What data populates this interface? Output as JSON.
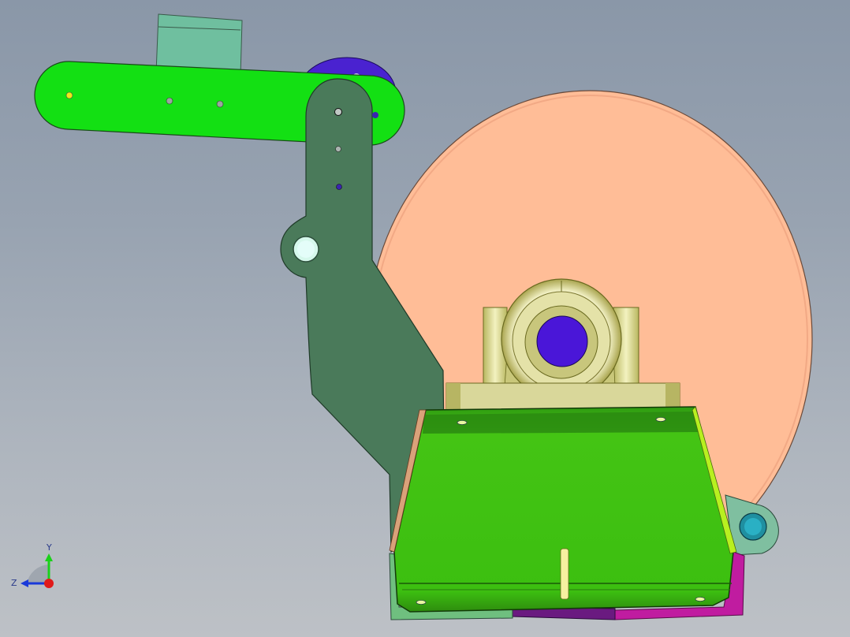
{
  "viewport": {
    "background_top": "#8a97a8",
    "background_bottom": "#bdc1c6"
  },
  "model": {
    "components": [
      {
        "name": "large-disk",
        "color": "#ffbd97"
      },
      {
        "name": "green-link-arm",
        "color": "#13e013"
      },
      {
        "name": "dark-green-bracket",
        "color": "#4a7a5a"
      },
      {
        "name": "mount-block",
        "color": "#6fbf9f"
      },
      {
        "name": "blue-pivot-disk",
        "color": "#4a22d0"
      },
      {
        "name": "pillow-block-bearing",
        "color": "#d8d89a"
      },
      {
        "name": "green-tray",
        "color": "#3cbf10"
      },
      {
        "name": "magenta-plate",
        "color": "#c01ca0"
      },
      {
        "name": "teal-pivot",
        "color": "#1f8fa0"
      }
    ]
  },
  "triad": {
    "y_label": "Y",
    "z_label": "Z",
    "y_color": "#1ad11a",
    "z_color": "#1a3ad9",
    "x_color": "#e01a1a"
  }
}
